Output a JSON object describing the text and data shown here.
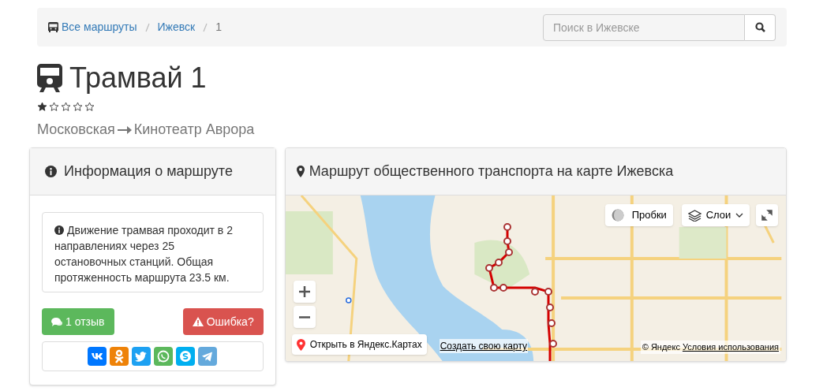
{
  "breadcrumb": [
    {
      "label": "Все маршруты",
      "link": true
    },
    {
      "label": "Ижевск",
      "link": true
    },
    {
      "label": "1",
      "link": false
    }
  ],
  "search": {
    "placeholder": "Поиск в Ижевске"
  },
  "title": "Трамвай 1",
  "rating": {
    "stars": 1
  },
  "route": {
    "from": "Московская",
    "to": "Кинотеатр Аврора"
  },
  "info_panel": {
    "title": "Информация о маршруте",
    "text": "Движение трамвая проходит в 2 направлениях через 25 остановочных станций. Общая протяженность маршрута 23.5 км.",
    "buttons": [
      {
        "kind": "reviews",
        "label": "1 отзыв"
      },
      {
        "kind": "error",
        "label": "Ошибка?"
      }
    ]
  },
  "map_panel": {
    "title": "Маршрут общественного транспорта на карте Ижевска",
    "controls": [
      {
        "kind": "traffic",
        "label": "Пробки"
      },
      {
        "kind": "layers",
        "label": "Слои"
      }
    ],
    "open_link": "Открыть в Яндекс.Картах",
    "create_link": "Создать свою карту",
    "copyright": "© Яндекс",
    "terms_link": "Условия использования"
  }
}
